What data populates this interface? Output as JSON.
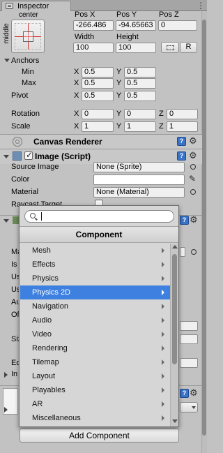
{
  "tab": {
    "title": "Inspector"
  },
  "rect": {
    "anchor_h": "center",
    "anchor_v": "middle",
    "pos_x_label": "Pos X",
    "pos_y_label": "Pos Y",
    "pos_z_label": "Pos Z",
    "pos_x": "-266.486",
    "pos_y": "-94.65663",
    "pos_z": "0",
    "width_label": "Width",
    "height_label": "Height",
    "width": "100",
    "height": "100",
    "r_button": "R",
    "anchors_label": "Anchors",
    "min_label": "Min",
    "max_label": "Max",
    "min_x": "0.5",
    "min_y": "0.5",
    "max_x": "0.5",
    "max_y": "0.5",
    "pivot_label": "Pivot",
    "pivot_x": "0.5",
    "pivot_y": "0.5",
    "rotation_label": "Rotation",
    "rot_x": "0",
    "rot_y": "0",
    "rot_z": "0",
    "scale_label": "Scale",
    "scale_x": "1",
    "scale_y": "1",
    "scale_z": "1",
    "x": "X",
    "y": "Y",
    "z": "Z"
  },
  "canvas_renderer": {
    "title": "Canvas Renderer"
  },
  "image": {
    "title": "Image (Script)",
    "source_label": "Source Image",
    "source_value": "None (Sprite)",
    "color_label": "Color",
    "material_label": "Material",
    "material_value": "None (Material)",
    "raycast_label": "Raycast Target"
  },
  "hidden_labels": {
    "l1": "Ma",
    "l2": "Is",
    "l3": "Us",
    "l4": "Us",
    "l5": "Au",
    "l6": "Of",
    "l7": "Siz",
    "l8": "Ed",
    "l9": "In"
  },
  "dropdown": {
    "search_placeholder": "",
    "title": "Component",
    "items": [
      {
        "label": "Mesh"
      },
      {
        "label": "Effects"
      },
      {
        "label": "Physics"
      },
      {
        "label": "Physics 2D"
      },
      {
        "label": "Navigation"
      },
      {
        "label": "Audio"
      },
      {
        "label": "Video"
      },
      {
        "label": "Rendering"
      },
      {
        "label": "Tilemap"
      },
      {
        "label": "Layout"
      },
      {
        "label": "Playables"
      },
      {
        "label": "AR"
      },
      {
        "label": "Miscellaneous"
      }
    ],
    "selected_index": 3
  },
  "add_component": {
    "label": "Add Component"
  },
  "colors": {
    "selection": "#3d80df",
    "panel": "#c2c2c2",
    "accent_help": "#3b73c7"
  }
}
